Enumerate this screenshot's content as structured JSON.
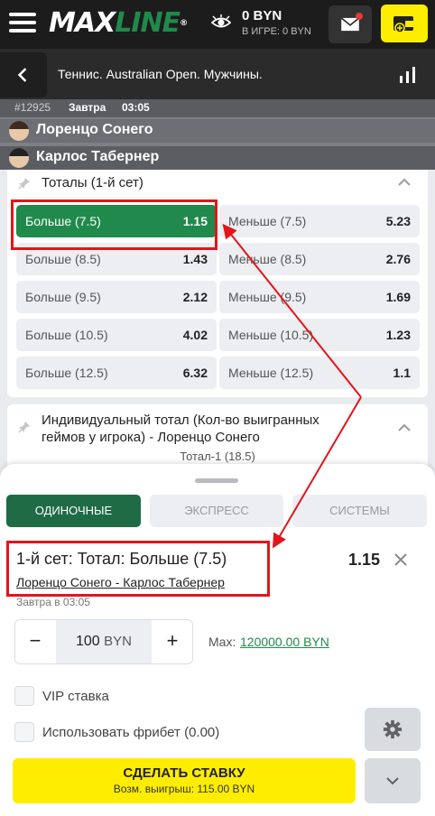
{
  "header": {
    "logo_max": "MAX",
    "logo_line": "LINE",
    "logo_reg": "®",
    "balance": "0 BYN",
    "in_game": "В ИГРЕ: 0 BYN"
  },
  "event": {
    "title": "Теннис. Australian Open. Мужчины.",
    "id": "#12925",
    "day": "Завтра",
    "time": "03:05",
    "player1": "Лоренцо Сонего",
    "player2": "Карлос Табернер"
  },
  "market_totals": {
    "title": "Тоталы (1-й сет)",
    "rows": [
      {
        "over_label": "Больше (7.5)",
        "over_odd": "1.15",
        "under_label": "Меньше (7.5)",
        "under_odd": "5.23"
      },
      {
        "over_label": "Больше (8.5)",
        "over_odd": "1.43",
        "under_label": "Меньше (8.5)",
        "under_odd": "2.76"
      },
      {
        "over_label": "Больше (9.5)",
        "over_odd": "2.12",
        "under_label": "Меньше (9.5)",
        "under_odd": "1.69"
      },
      {
        "over_label": "Больше (10.5)",
        "over_odd": "4.02",
        "under_label": "Меньше (10.5)",
        "under_odd": "1.23"
      },
      {
        "over_label": "Больше (12.5)",
        "over_odd": "6.32",
        "under_label": "Меньше (12.5)",
        "under_odd": "1.1"
      }
    ]
  },
  "market_individual": {
    "title": "Индивидуальный тотал (Кол-во выигранных геймов у игрока) - Лоренцо Сонего",
    "subtitle": "Тотал-1 (18.5)"
  },
  "betslip": {
    "tabs": [
      "ОДИНОЧНЫЕ",
      "ЭКСПРЕСС",
      "СИСТЕМЫ"
    ],
    "bet_title": "1-й сет: Тотал: Больше (7.5)",
    "bet_odds": "1.15",
    "bet_match": "Лоренцо Сонего - Карлос Табернер",
    "bet_time": "Завтра в 03:05",
    "stake_minus": "−",
    "stake_plus": "+",
    "stake_value": "100",
    "stake_currency": "BYN",
    "max_label": "Max:",
    "max_value": "120000.00 BYN",
    "vip_label": "VIP ставка",
    "freebet_label": "Использовать фрибет (0.00)",
    "place_bet_label": "СДЕЛАТЬ СТАВКУ",
    "possible_win": "Возм. выигрыш: 115.00 BYN"
  },
  "colors": {
    "accent_green": "#1f8a4c",
    "tab_green": "#1e6b45",
    "yellow": "#ffed00",
    "annotation_red": "#e3151a"
  }
}
